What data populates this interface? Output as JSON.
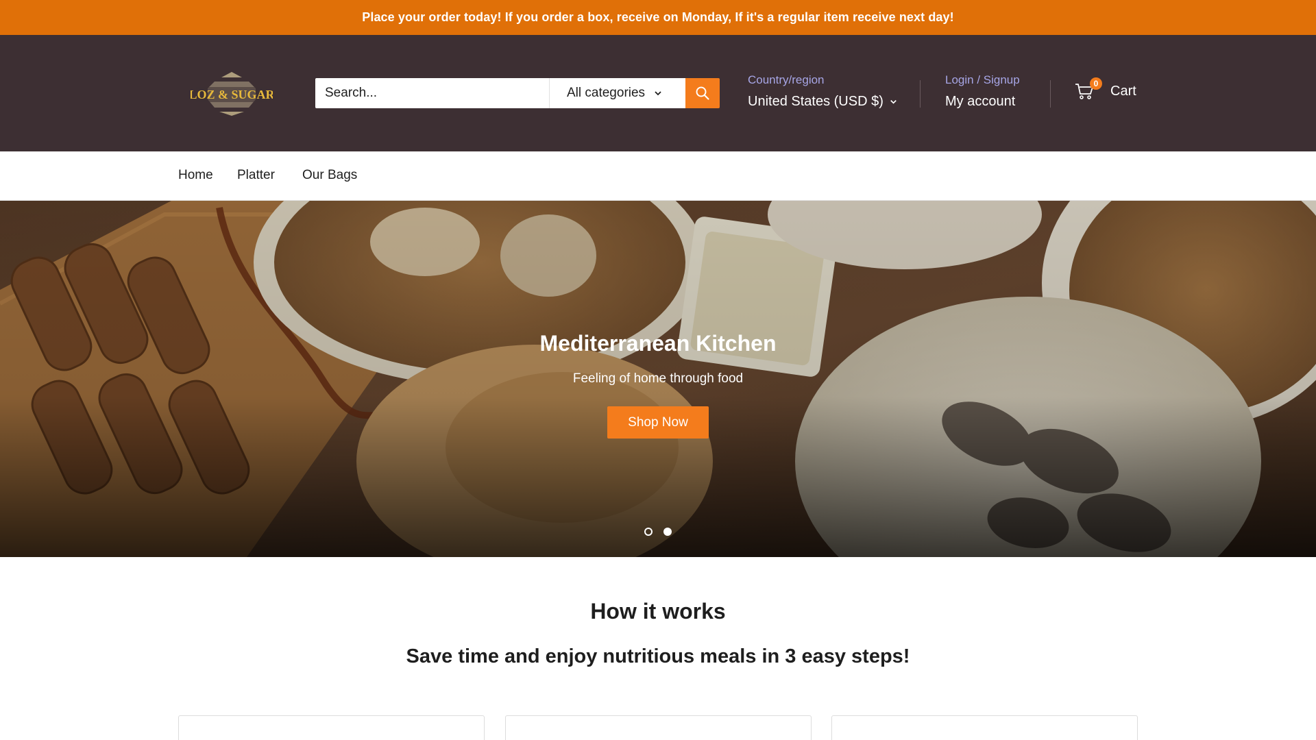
{
  "announcement": {
    "text": "Place your order today! If you order a box, receive on Monday, If it's a regular item receive next day!"
  },
  "header": {
    "logo_text": "LOZ & SUGAR",
    "search": {
      "placeholder": "Search...",
      "category": "All categories"
    },
    "region": {
      "label": "Country/region",
      "value": "United States (USD $)"
    },
    "account": {
      "login_label": "Login / Signup",
      "my_account": "My account"
    },
    "cart": {
      "count": "0",
      "label": "Cart"
    }
  },
  "nav": {
    "items": [
      "Home",
      "Platter",
      "Our Bags"
    ]
  },
  "hero": {
    "title": "Mediterranean Kitchen",
    "subtitle": "Feeling of home through food",
    "cta": "Shop Now",
    "slides": 2,
    "active_slide": 2
  },
  "how_it_works": {
    "title": "How it works",
    "subtitle": "Save time and enjoy nutritious meals in 3 easy steps!"
  },
  "colors": {
    "announcement_bg": "#e07008",
    "header_bg": "#3d2f33",
    "accent": "#f47c1c",
    "link": "#a7a6e6"
  }
}
